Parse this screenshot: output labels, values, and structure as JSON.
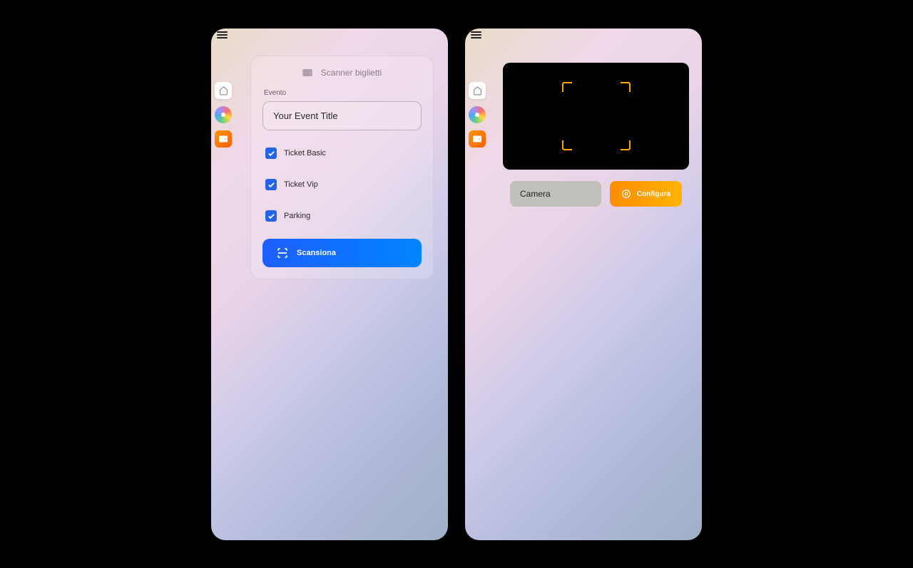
{
  "device1": {
    "panel_title": "Scanner biglietti",
    "event_label": "Evento",
    "event_value": "Your Event Title",
    "checkboxes": [
      {
        "label": "Ticket Basic",
        "checked": true
      },
      {
        "label": "Ticket Vip",
        "checked": true
      },
      {
        "label": "Parking",
        "checked": true
      }
    ],
    "scan_button": "Scansiona",
    "sidebar": [
      "home",
      "gradient",
      "scanner"
    ]
  },
  "device2": {
    "camera_select": "Camera",
    "config_button": "Configura",
    "sidebar": [
      "home",
      "gradient",
      "scanner"
    ]
  },
  "colors": {
    "checkbox_blue": "#2563eb",
    "scan_gradient_start": "#1e5fff",
    "scan_gradient_end": "#0084ff",
    "config_gradient_start": "#ff8c00",
    "config_gradient_end": "#ffb400",
    "focus_frame": "#ffa500"
  }
}
